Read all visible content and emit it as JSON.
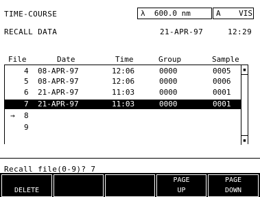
{
  "header": {
    "title": "TIME-COURSE",
    "subtitle": "RECALL DATA",
    "wavelength": "λ  600.0 nm",
    "mode": "A    VIS",
    "date": "21-APR-97",
    "time": "12:29"
  },
  "table": {
    "columns": [
      "File",
      "Date",
      "Time",
      "Group",
      "Sample"
    ],
    "rows": [
      {
        "file": "4",
        "date": "08-APR-97",
        "time": "12:06",
        "group": "0000",
        "sample": "0005",
        "marker": ""
      },
      {
        "file": "5",
        "date": "08-APR-97",
        "time": "12:06",
        "group": "0000",
        "sample": "0006",
        "marker": ""
      },
      {
        "file": "6",
        "date": "21-APR-97",
        "time": "11:03",
        "group": "0000",
        "sample": "0001",
        "marker": ""
      },
      {
        "file": "7",
        "date": "21-APR-97",
        "time": "11:03",
        "group": "0000",
        "sample": "0001",
        "marker": ""
      },
      {
        "file": "8",
        "date": "",
        "time": "",
        "group": "",
        "sample": "",
        "marker": "→"
      },
      {
        "file": "9",
        "date": "",
        "time": "",
        "group": "",
        "sample": "",
        "marker": ""
      }
    ],
    "selected_index": 3,
    "scroll_up_glyph": "▪",
    "scroll_down_glyph": "▪"
  },
  "prompt": "Recall file(0-9)? 7",
  "softkeys": [
    {
      "top": "",
      "bottom": "DELETE"
    },
    {
      "top": "",
      "bottom": ""
    },
    {
      "top": "",
      "bottom": ""
    },
    {
      "top": "PAGE",
      "bottom": "UP"
    },
    {
      "top": "PAGE",
      "bottom": "DOWN"
    }
  ]
}
